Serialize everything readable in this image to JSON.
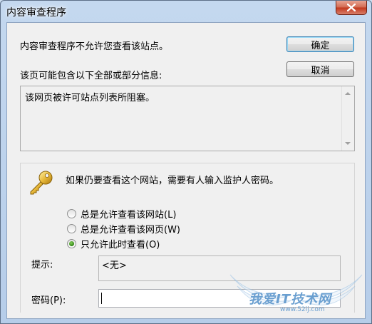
{
  "window": {
    "title": "内容审查程序"
  },
  "dialog": {
    "message": "内容审查程序不允许您查看该站点。",
    "info_label": "该页可能包含以下全部或部分信息:",
    "info_content": "该网页被许可站点列表所阻塞。",
    "ok_label": "确定",
    "cancel_label": "取消"
  },
  "auth": {
    "message": "如果仍要查看这个网站，需要有人输入监护人密码。",
    "options": [
      {
        "label": "总是允许查看该网站(L)",
        "checked": false
      },
      {
        "label": "总是允许查看该网页(W)",
        "checked": false
      },
      {
        "label": "只允许此时查看(O)",
        "checked": true
      }
    ],
    "hint_label": "提示:",
    "hint_value": "<无>",
    "password_label": "密码(P):",
    "password_value": ""
  },
  "watermark": {
    "text": "我爱IT技术网",
    "url": "www.52ij.com"
  },
  "icons": {
    "key": "key-icon",
    "close": "close-icon"
  },
  "colors": {
    "title_bar": "#c4d8ef",
    "close_button": "#c2381d",
    "client": "#f0f0f0",
    "radio_checked": "#287d0f"
  }
}
